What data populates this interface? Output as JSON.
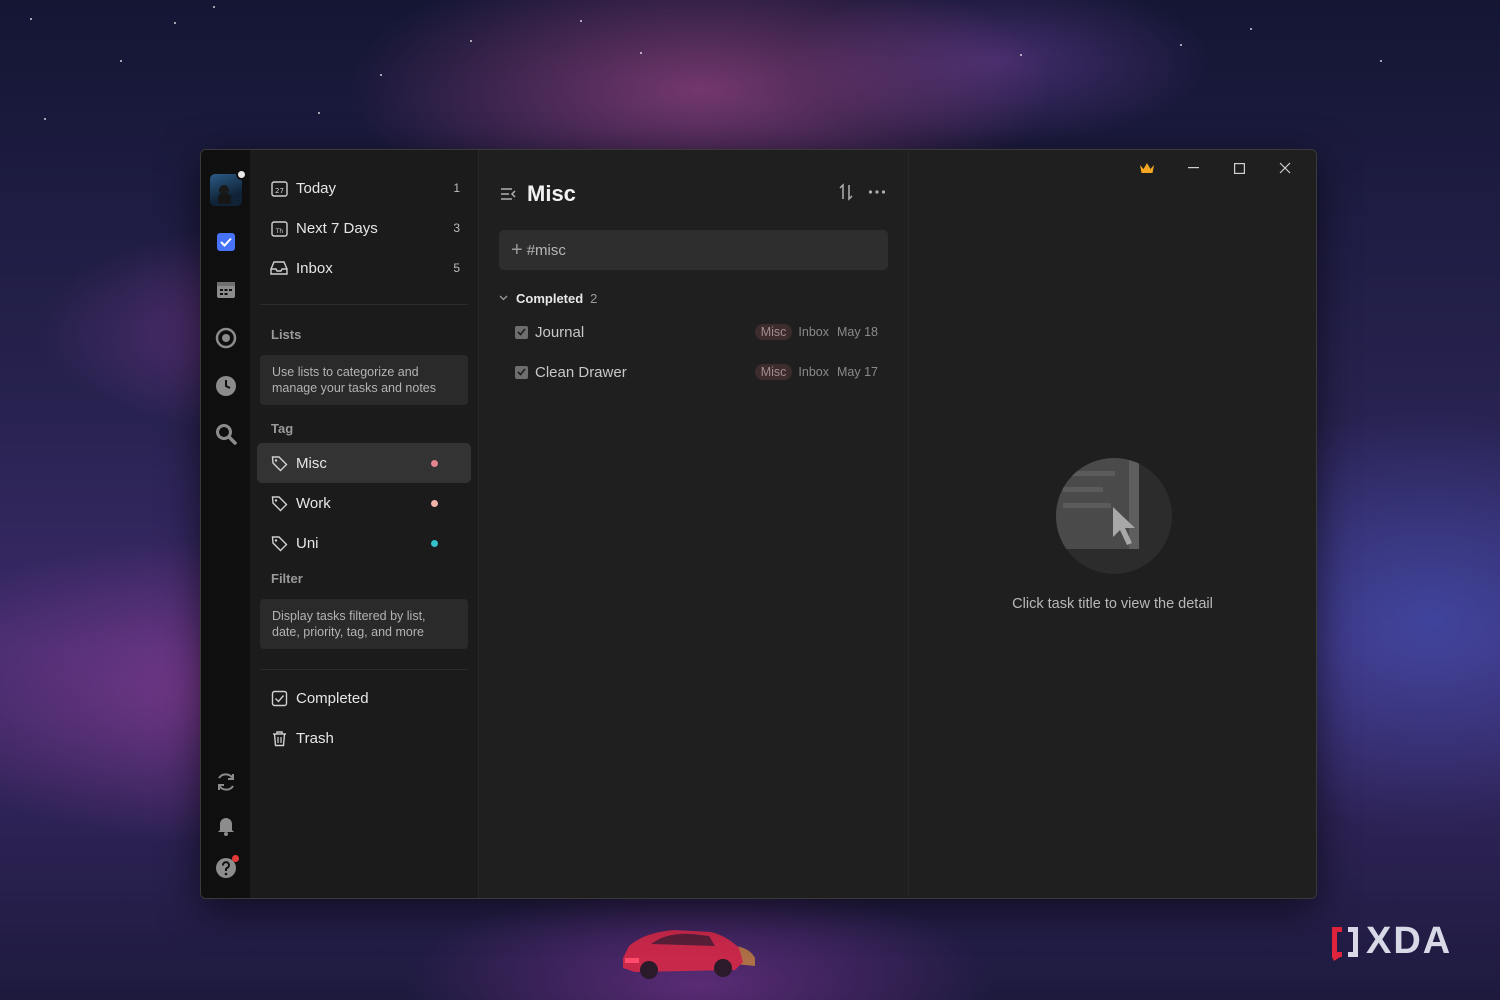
{
  "sidebar": {
    "smart_lists": [
      {
        "label": "Today",
        "count": "1",
        "icon": "calendar-today-icon"
      },
      {
        "label": "Next 7 Days",
        "count": "3",
        "icon": "calendar-week-icon"
      },
      {
        "label": "Inbox",
        "count": "5",
        "icon": "inbox-icon"
      }
    ],
    "lists_label": "Lists",
    "lists_hint": "Use lists to categorize and manage your tasks and notes",
    "tag_label": "Tag",
    "tags": [
      {
        "label": "Misc",
        "color": "#e2858f"
      },
      {
        "label": "Work",
        "color": "#f3b3a9"
      },
      {
        "label": "Uni",
        "color": "#35c1cc"
      }
    ],
    "filter_label": "Filter",
    "filter_hint": "Display tasks filtered by list, date, priority, tag, and more",
    "bottom_items": [
      {
        "label": "Completed",
        "icon": "check-square-icon"
      },
      {
        "label": "Trash",
        "icon": "trash-icon"
      }
    ]
  },
  "main": {
    "title": "Misc",
    "add_placeholder": "#misc",
    "group": {
      "label": "Completed",
      "count": "2"
    },
    "tasks": [
      {
        "title": "Journal",
        "tag": "Misc",
        "list": "Inbox",
        "date": "May 18"
      },
      {
        "title": "Clean Drawer",
        "tag": "Misc",
        "list": "Inbox",
        "date": "May 17"
      }
    ]
  },
  "detail": {
    "empty_text": "Click task title to view the detail"
  },
  "watermark": {
    "text": "XDA"
  },
  "colors": {
    "accent": "#4772fa",
    "crown": "#f5a623"
  }
}
